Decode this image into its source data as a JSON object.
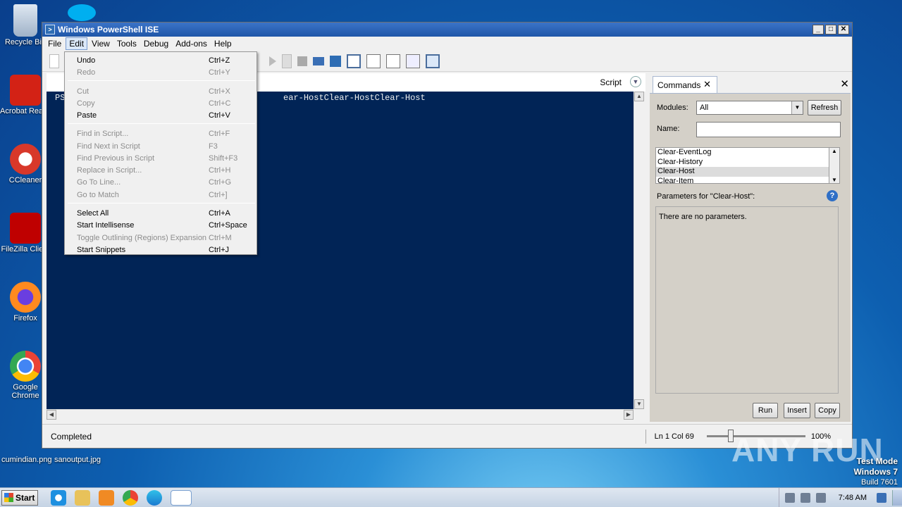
{
  "desktop": {
    "icons": [
      {
        "label": "Recycle Bin",
        "icon": "recycle-bin-icon"
      },
      {
        "label": "Acrobat Reader DC",
        "icon": "acrobat-icon"
      },
      {
        "label": "CCleaner",
        "icon": "ccleaner-icon"
      },
      {
        "label": "FileZilla Client",
        "icon": "filezilla-icon"
      },
      {
        "label": "Firefox",
        "icon": "firefox-icon"
      },
      {
        "label": "Google Chrome",
        "icon": "chrome-icon"
      }
    ],
    "files": [
      "cumindian.png",
      "sanoutput.jpg"
    ],
    "watermark": "ANY RUN",
    "test_mode": [
      "Test Mode",
      "Windows 7",
      "Build 7601"
    ]
  },
  "window": {
    "title": "Windows PowerShell ISE",
    "controls": [
      "_",
      "□",
      "✕"
    ],
    "menus": [
      "File",
      "Edit",
      "View",
      "Tools",
      "Debug",
      "Add-ons",
      "Help"
    ],
    "script_label": "Script",
    "console_text": "PS                                           ear-HostClear-HostClear-Host",
    "status": "Completed",
    "position": "Ln 1  Col 69",
    "zoom": "100%",
    "zoom_fraction": 0.24
  },
  "edit_menu": {
    "items": [
      {
        "label": "Undo",
        "shortcut": "Ctrl+Z",
        "enabled": true
      },
      {
        "label": "Redo",
        "shortcut": "Ctrl+Y",
        "enabled": false
      },
      {
        "label": "Cut",
        "shortcut": "Ctrl+X",
        "enabled": false
      },
      {
        "label": "Copy",
        "shortcut": "Ctrl+C",
        "enabled": false
      },
      {
        "label": "Paste",
        "shortcut": "Ctrl+V",
        "enabled": true
      },
      {
        "label": "Find in Script...",
        "shortcut": "Ctrl+F",
        "enabled": false
      },
      {
        "label": "Find Next in Script",
        "shortcut": "F3",
        "enabled": false
      },
      {
        "label": "Find Previous in Script",
        "shortcut": "Shift+F3",
        "enabled": false
      },
      {
        "label": "Replace in Script...",
        "shortcut": "Ctrl+H",
        "enabled": false
      },
      {
        "label": "Go To Line...",
        "shortcut": "Ctrl+G",
        "enabled": false
      },
      {
        "label": "Go to Match",
        "shortcut": "Ctrl+]",
        "enabled": false
      },
      {
        "label": "Select All",
        "shortcut": "Ctrl+A",
        "enabled": true
      },
      {
        "label": "Start Intellisense",
        "shortcut": "Ctrl+Space",
        "enabled": true
      },
      {
        "label": "Toggle Outlining (Regions) Expansion",
        "shortcut": "Ctrl+M",
        "enabled": false
      },
      {
        "label": "Start Snippets",
        "shortcut": "Ctrl+J",
        "enabled": true
      }
    ]
  },
  "commands": {
    "tab": "Commands",
    "modules_label": "Modules:",
    "modules_value": "All",
    "refresh": "Refresh",
    "name_label": "Name:",
    "name_value": "",
    "list": [
      "Clear-EventLog",
      "Clear-History",
      "Clear-Host",
      "Clear-Item"
    ],
    "selected": "Clear-Host",
    "params_label": "Parameters for \"Clear-Host\":",
    "params_text": "There are no parameters.",
    "run": "Run",
    "insert": "Insert",
    "copy": "Copy"
  },
  "taskbar": {
    "start": "Start",
    "time": "7:48 AM"
  }
}
